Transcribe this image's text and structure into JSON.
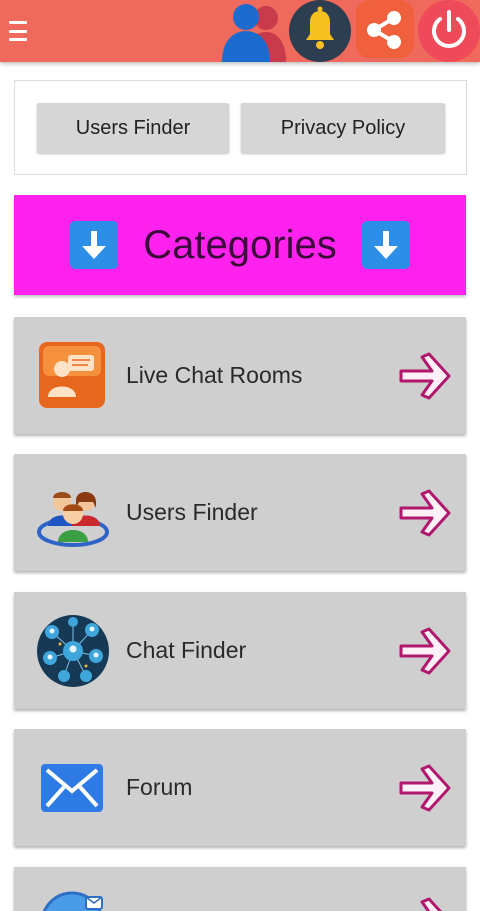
{
  "appbar": {
    "icons": [
      "menu-icon",
      "users-icon",
      "bell-icon",
      "share-icon",
      "power-icon"
    ],
    "colors": {
      "background": "#ef6a5c",
      "bell_bg": "#2d3e50",
      "share_bg": "#f0603c",
      "power_bg": "#ef4a5a"
    }
  },
  "top_buttons": {
    "users_finder": "Users Finder",
    "privacy_policy": "Privacy Policy"
  },
  "categories": {
    "title": "Categories",
    "arrow_icon": "down-arrow-icon",
    "background": "#ff22ee"
  },
  "items": [
    {
      "label": "Live Chat Rooms",
      "icon": "chat-rooms-icon"
    },
    {
      "label": "Users Finder",
      "icon": "users-group-icon"
    },
    {
      "label": "Chat Finder",
      "icon": "chat-network-icon"
    },
    {
      "label": "Forum",
      "icon": "envelope-icon"
    },
    {
      "label": "",
      "icon": "globe-mail-icon"
    }
  ]
}
